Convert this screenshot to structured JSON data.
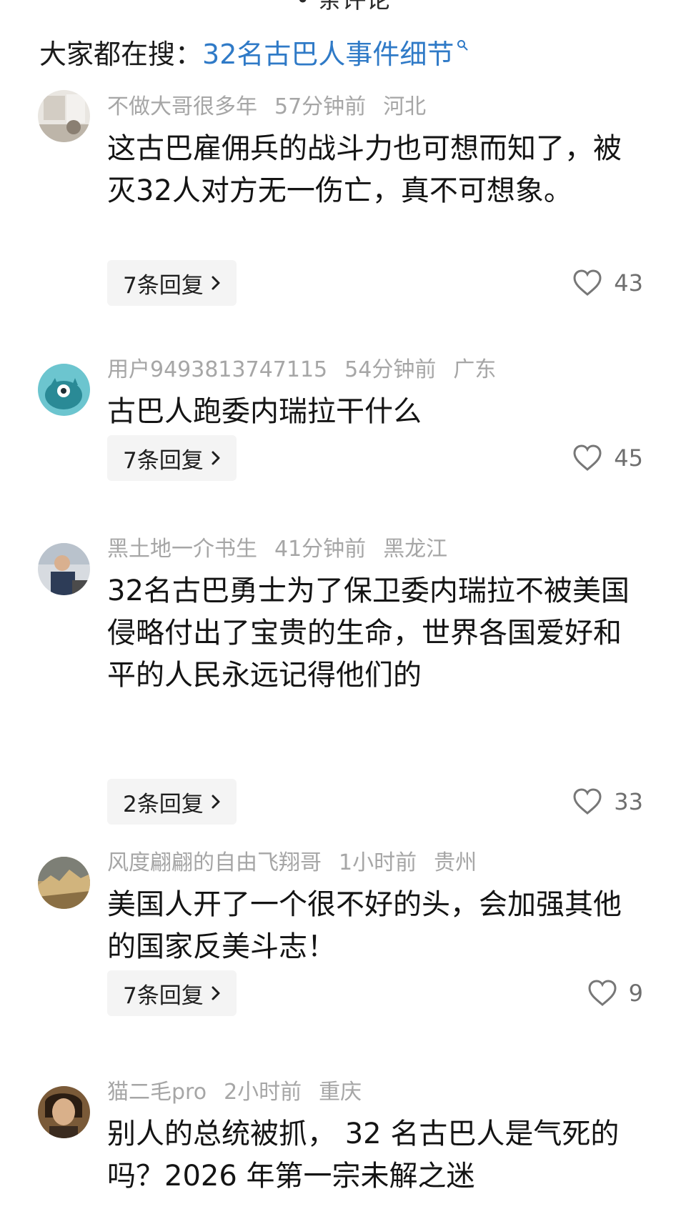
{
  "header": {
    "partial_title": "• 条评论",
    "search_prefix": "大家都在搜：",
    "search_term": "32名古巴人事件细节"
  },
  "comments": [
    {
      "author": "不做大哥很多年",
      "time": "57分钟前",
      "region": "河北",
      "text": "这古巴雇佣兵的战斗力也可想而知了，被灭32人对方无一伤亡，真不可想象。",
      "replies": "7条回复",
      "likes": "43"
    },
    {
      "author": "用户9493813747115",
      "time": "54分钟前",
      "region": "广东",
      "text": "古巴人跑委内瑞拉干什么",
      "replies": "7条回复",
      "likes": "45"
    },
    {
      "author": "黑土地一介书生",
      "time": "41分钟前",
      "region": "黑龙江",
      "text": "32名古巴勇士为了保卫委内瑞拉不被美国侵略付出了宝贵的生命，世界各国爱好和平的人民永远记得他们的",
      "replies": "2条回复",
      "likes": "33"
    },
    {
      "author": "风度翩翩的自由飞翔哥",
      "time": "1小时前",
      "region": "贵州",
      "text": "美国人开了一个很不好的头，会加强其他的国家反美斗志！",
      "replies": "7条回复",
      "likes": "9"
    },
    {
      "author": "猫二毛pro",
      "time": "2小时前",
      "region": "重庆",
      "text": "别人的总统被抓， 32 名古巴人是气死的吗？2026 年第一宗未解之迷"
    }
  ],
  "icons": {
    "search": "search-icon",
    "like": "heart-icon",
    "chevron": "chevron-right-icon"
  },
  "colors": {
    "link": "#2f7ac7",
    "meta": "#a6a6a6",
    "reply_bg": "#f4f4f4"
  }
}
